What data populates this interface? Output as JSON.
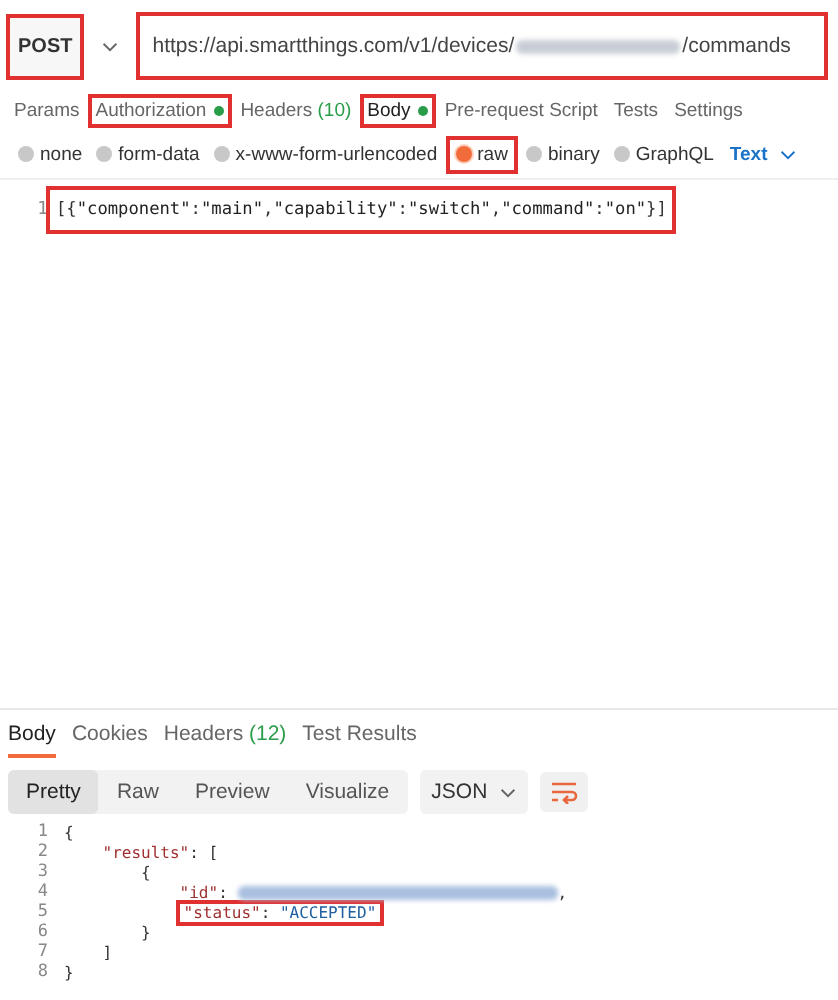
{
  "request": {
    "method": "POST",
    "method_highlighted": true,
    "url_parts": [
      {
        "kind": "text",
        "text": "https://api.smartthings.com/v1/devices/"
      },
      {
        "kind": "redacted"
      },
      {
        "kind": "text",
        "text": "/commands"
      }
    ],
    "url_highlighted": true
  },
  "request_tabs": [
    {
      "label": "Params",
      "selected": false,
      "highlighted": false
    },
    {
      "label": "Authorization",
      "selected": false,
      "highlighted": true,
      "dot": true
    },
    {
      "label": "Headers",
      "count": "(10)",
      "selected": false,
      "highlighted": false
    },
    {
      "label": "Body",
      "selected": true,
      "highlighted": true,
      "dot": true
    },
    {
      "label": "Pre-request Script",
      "selected": false,
      "highlighted": false
    },
    {
      "label": "Tests",
      "selected": false,
      "highlighted": false
    },
    {
      "label": "Settings",
      "selected": false,
      "highlighted": false
    }
  ],
  "body_types": [
    {
      "label": "none",
      "selected": false,
      "highlighted": false
    },
    {
      "label": "form-data",
      "selected": false,
      "highlighted": false
    },
    {
      "label": "x-www-form-urlencoded",
      "selected": false,
      "highlighted": false
    },
    {
      "label": "raw",
      "selected": true,
      "highlighted": true
    },
    {
      "label": "binary",
      "selected": false,
      "highlighted": false
    },
    {
      "label": "GraphQL",
      "selected": false,
      "highlighted": false
    }
  ],
  "body_format": "Text",
  "request_body": {
    "highlighted": true,
    "lines": [
      {
        "num": "1",
        "segments": [
          {
            "kind": "punct",
            "text": "[{"
          },
          {
            "kind": "key",
            "text": "\"component\""
          },
          {
            "kind": "punct",
            "text": ":"
          },
          {
            "kind": "string",
            "text": "\"main\""
          },
          {
            "kind": "punct",
            "text": ","
          },
          {
            "kind": "key",
            "text": "\"capability\""
          },
          {
            "kind": "punct",
            "text": ":"
          },
          {
            "kind": "string",
            "text": "\"switch\""
          },
          {
            "kind": "punct",
            "text": ","
          },
          {
            "kind": "key",
            "text": "\"command\""
          },
          {
            "kind": "punct",
            "text": ":"
          },
          {
            "kind": "string",
            "text": "\"on\""
          },
          {
            "kind": "punct",
            "text": "}]"
          }
        ]
      }
    ]
  },
  "response_tabs": [
    {
      "label": "Body",
      "selected": true
    },
    {
      "label": "Cookies",
      "selected": false
    },
    {
      "label": "Headers",
      "count": "(12)",
      "selected": false
    },
    {
      "label": "Test Results",
      "selected": false
    }
  ],
  "view_modes": [
    {
      "label": "Pretty",
      "selected": true
    },
    {
      "label": "Raw",
      "selected": false
    },
    {
      "label": "Preview",
      "selected": false
    },
    {
      "label": "Visualize",
      "selected": false
    }
  ],
  "response_format": "JSON",
  "response_body": [
    {
      "num": "1",
      "highlighted": false,
      "segments": [
        {
          "kind": "punct",
          "text": "{"
        }
      ]
    },
    {
      "num": "2",
      "highlighted": false,
      "segments": [
        {
          "kind": "key",
          "text": "    \"results\""
        },
        {
          "kind": "punct",
          "text": ": ["
        }
      ]
    },
    {
      "num": "3",
      "highlighted": false,
      "segments": [
        {
          "kind": "punct",
          "text": "        {"
        }
      ]
    },
    {
      "num": "4",
      "highlighted": false,
      "segments": [
        {
          "kind": "key",
          "text": "            \"id\""
        },
        {
          "kind": "punct",
          "text": ": "
        },
        {
          "kind": "redacted"
        },
        {
          "kind": "punct",
          "text": ","
        }
      ]
    },
    {
      "num": "5",
      "highlighted": true,
      "segments": [
        {
          "kind": "key",
          "text": "\"status\""
        },
        {
          "kind": "punct",
          "text": ": "
        },
        {
          "kind": "string",
          "text": "\"ACCEPTED\""
        }
      ]
    },
    {
      "num": "6",
      "highlighted": false,
      "segments": [
        {
          "kind": "punct",
          "text": "        }"
        }
      ]
    },
    {
      "num": "7",
      "highlighted": false,
      "segments": [
        {
          "kind": "punct",
          "text": "    ]"
        }
      ]
    },
    {
      "num": "8",
      "highlighted": false,
      "segments": [
        {
          "kind": "punct",
          "text": "}"
        }
      ]
    }
  ]
}
